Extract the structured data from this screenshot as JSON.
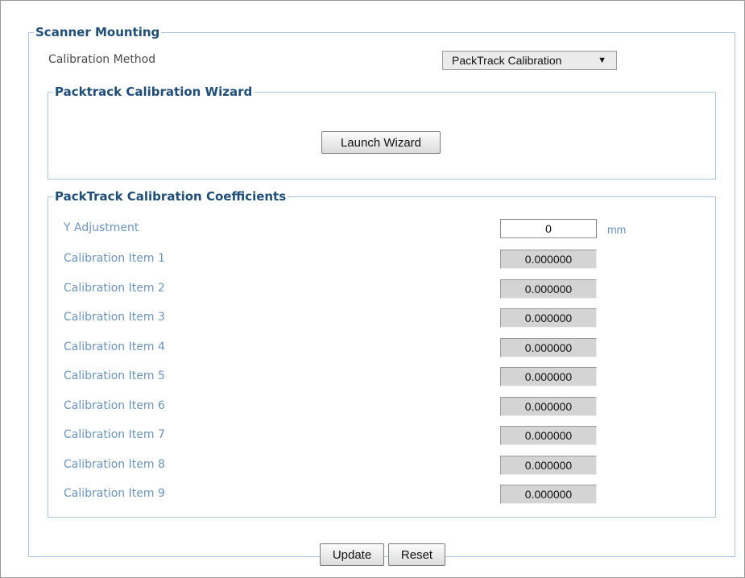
{
  "scanner_mounting": {
    "legend": "Scanner Mounting",
    "calibration_method_label": "Calibration Method",
    "calibration_method_value": "PackTrack Calibration",
    "dropdown_arrow": "▼"
  },
  "wizard": {
    "legend": "Packtrack Calibration Wizard",
    "launch_label": "Launch Wizard"
  },
  "coefficients": {
    "legend": "PackTrack Calibration Coefficients",
    "y_adjustment_label": "Y Adjustment",
    "y_adjustment_value": "0",
    "y_adjustment_unit": "mm",
    "items": [
      {
        "label": "Calibration Item 1",
        "value": "0.000000"
      },
      {
        "label": "Calibration Item 2",
        "value": "0.000000"
      },
      {
        "label": "Calibration Item 3",
        "value": "0.000000"
      },
      {
        "label": "Calibration Item 4",
        "value": "0.000000"
      },
      {
        "label": "Calibration Item 5",
        "value": "0.000000"
      },
      {
        "label": "Calibration Item 6",
        "value": "0.000000"
      },
      {
        "label": "Calibration Item 7",
        "value": "0.000000"
      },
      {
        "label": "Calibration Item 8",
        "value": "0.000000"
      },
      {
        "label": "Calibration Item 9",
        "value": "0.000000"
      }
    ]
  },
  "footer": {
    "update_label": "Update",
    "reset_label": "Reset"
  },
  "colors": {
    "legend_text": "#1f4e79",
    "fieldset_border": "#a9c6e2",
    "coef_label_text": "#6b95bf",
    "readonly_field_bg": "#d4d4d4"
  }
}
